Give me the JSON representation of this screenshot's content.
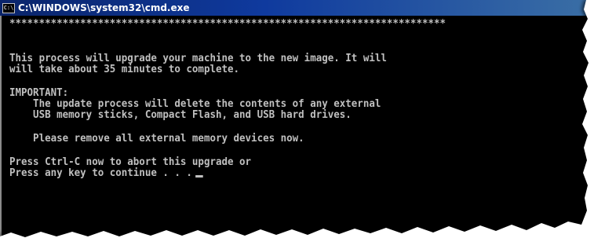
{
  "window": {
    "title": "C:\\WINDOWS\\system32\\cmd.exe",
    "icon": "cmd-icon",
    "icon_glyph": "C:\\"
  },
  "console": {
    "lines": [
      "**************************************************************************",
      "This process will upgrade your machine to the new image. It will",
      "will take about 35 minutes to complete.",
      "IMPORTANT:",
      "    The update process will delete the contents of any external",
      "    USB memory sticks, Compact Flash, and USB hard drives.",
      "    Please remove all external memory devices now.",
      "Press Ctrl-C now to abort this upgrade or",
      "Press any key to continue . . ."
    ]
  },
  "colors": {
    "console_bg": "#000000",
    "console_text": "#c0c0c0",
    "titlebar_start": "#0a246a",
    "titlebar_end": "#3a6ea5",
    "title_text": "#ffffff"
  }
}
